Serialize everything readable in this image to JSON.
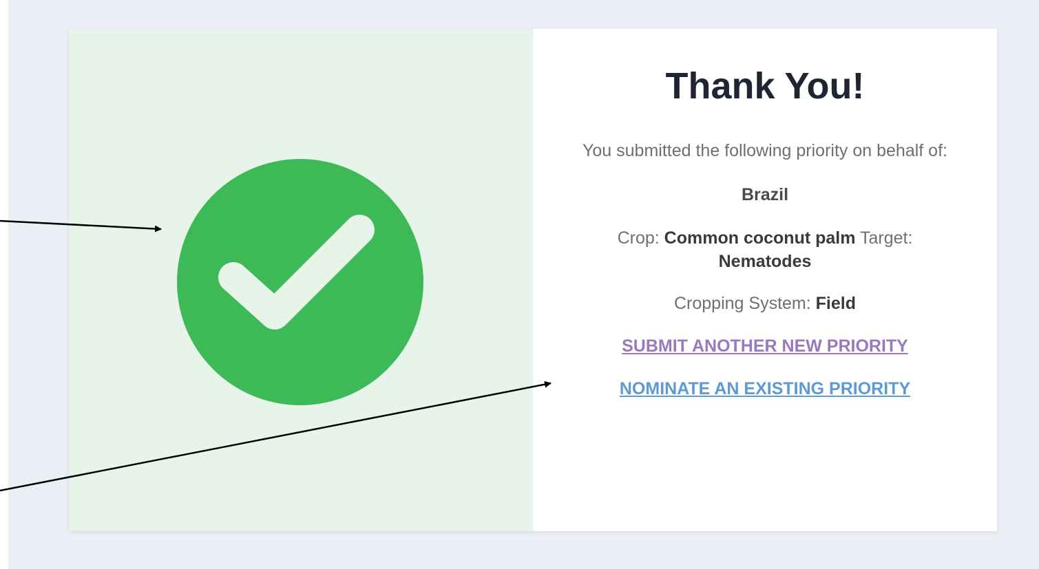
{
  "confirmation": {
    "title": "Thank You!",
    "subtitle": "You submitted the following priority on behalf of:",
    "country": "Brazil",
    "crop_label": "Crop:",
    "crop_value": "Common coconut palm",
    "target_label": "Target:",
    "target_value": "Nematodes",
    "cropping_system_label": "Cropping System:",
    "cropping_system_value": "Field"
  },
  "links": {
    "submit_another": "SUBMIT ANOTHER NEW PRIORITY",
    "nominate_existing": "NOMINATE AN EXISTING PRIORITY"
  },
  "icons": {
    "success": "checkmark-icon"
  },
  "colors": {
    "success_green": "#3dba57",
    "left_panel_bg": "#e6f4ea",
    "page_bg": "#eceef5",
    "link_visited": "#9b77bd",
    "link_default": "#5c9ad6",
    "title_text": "#1f2533"
  }
}
